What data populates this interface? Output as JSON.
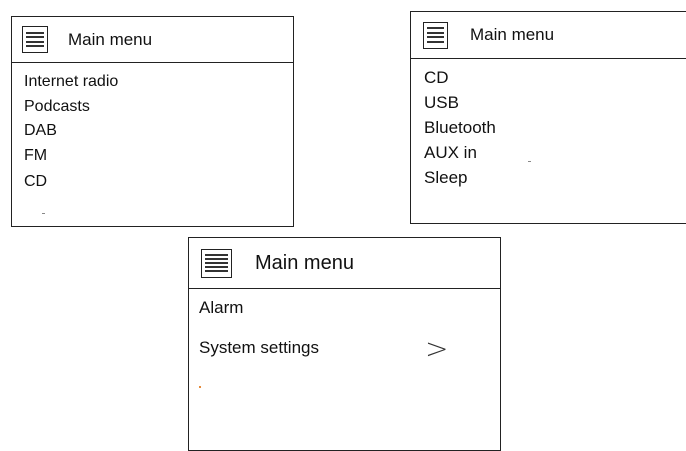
{
  "screens": [
    {
      "header": {
        "icon": "menu-list-icon",
        "title": "Main menu"
      },
      "items": [
        "Internet radio",
        "Podcasts",
        "DAB",
        "FM",
        "CD"
      ]
    },
    {
      "header": {
        "icon": "menu-list-icon",
        "title": "Main menu"
      },
      "items": [
        "CD",
        "USB",
        "Bluetooth",
        "AUX in",
        "Sleep"
      ]
    },
    {
      "header": {
        "icon": "menu-list-icon",
        "title": "Main menu"
      },
      "items": [
        "Alarm",
        "System settings"
      ],
      "submenu_indicator": ">"
    }
  ]
}
